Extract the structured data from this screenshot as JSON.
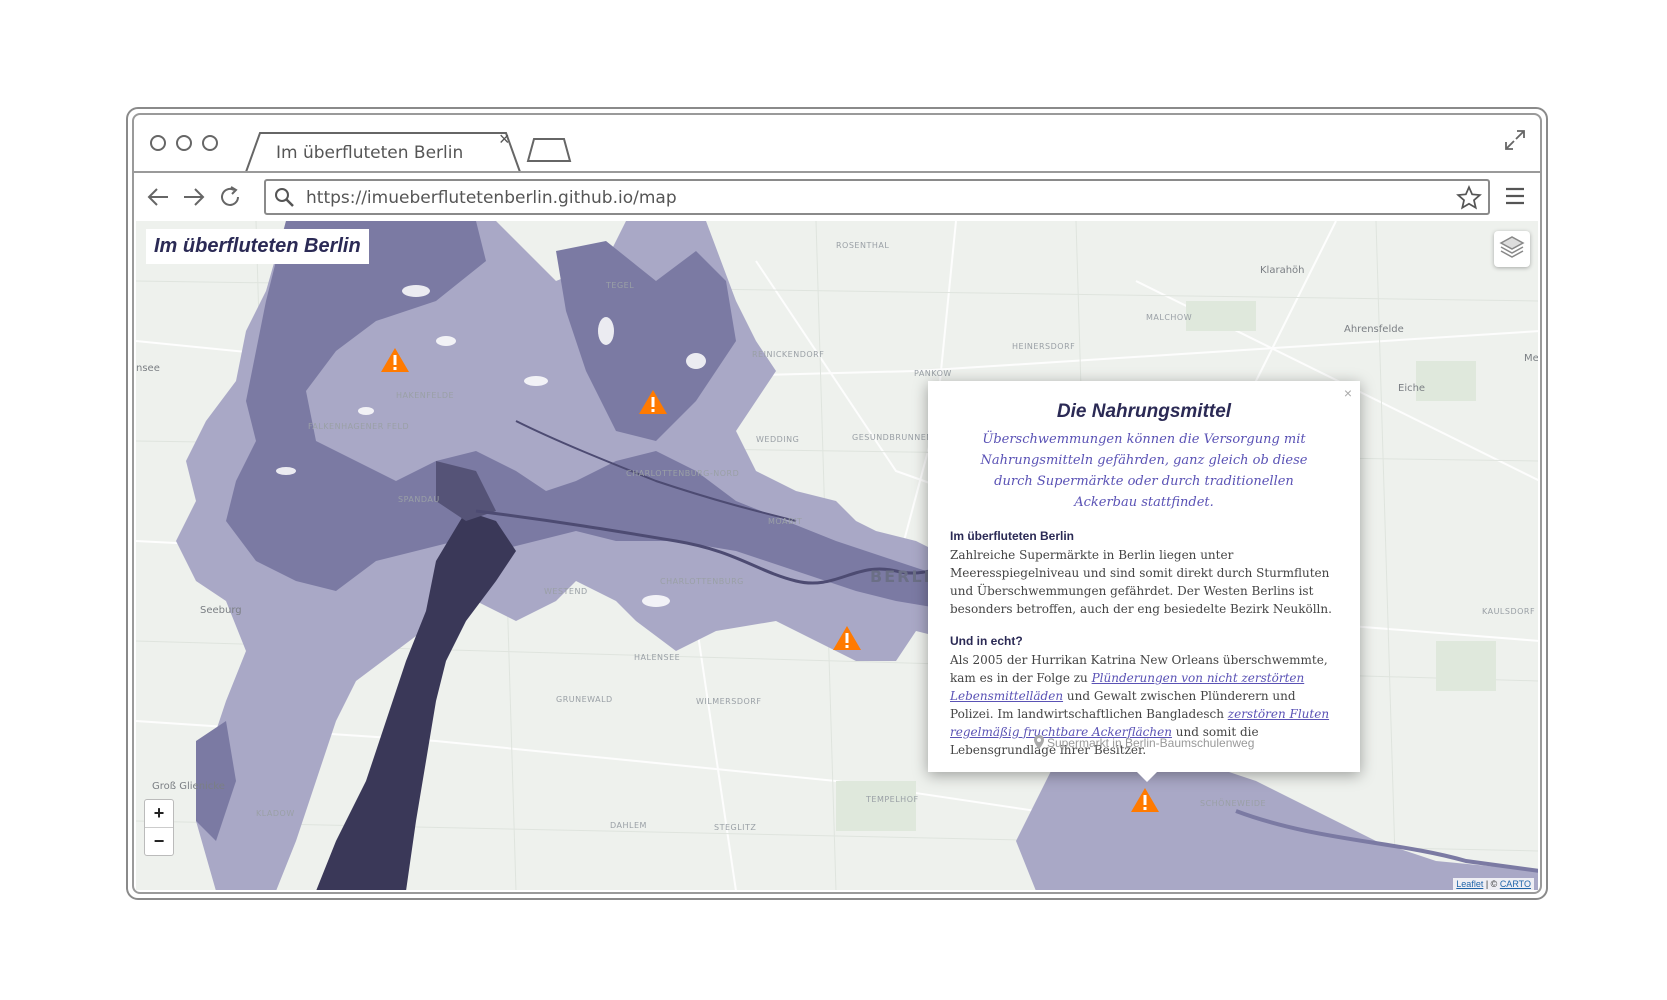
{
  "browser": {
    "tab_title": "Im überfluteten Berlin",
    "tab_close": "×",
    "url": "https://imueberflutetenberlin.github.io/map"
  },
  "map": {
    "title": "Im überfluteten Berlin",
    "zoom_in": "+",
    "zoom_out": "−",
    "attribution_leaflet": "Leaflet",
    "attribution_sep": " | © ",
    "attribution_carto": "CARTO",
    "places": {
      "rosenthal": "ROSENTHAL",
      "klaraoh": "Klarahöh",
      "tegel": "TEGEL",
      "malchow": "MALCHOW",
      "ahrensfelde": "Ahrensfelde",
      "heinersdorf": "HEINERSDORF",
      "reinickendorf": "REINICKENDORF",
      "see": "nsee",
      "mahlsdorf": "Me",
      "pankow": "PANKOW",
      "eiche": "Eiche",
      "falkenhagener": "FALKENHAGENER FELD",
      "wedding": "WEDDING",
      "gesundbrunnen": "GESUNDBRUNNEN",
      "hakenfelde": "HAKENFELDE",
      "spandau": "SPANDAU",
      "charlottenburg_nord": "CHARLOTTENBURG-NORD",
      "moabit": "MOABIT",
      "berlin": "BERLIN",
      "westend": "WESTEND",
      "charlottenburg": "CHARLOTTENBURG",
      "seeburg": "Seeburg",
      "halensee": "HALENSEE",
      "grunewald": "GRUNEWALD",
      "wilmersdorf": "WILMERSDORF",
      "gross_glienicke": "Groß Glienicke",
      "kladow": "KLADOW",
      "dahlem": "DAHLEM",
      "steglitz": "STEGLITZ",
      "tempelhof": "TEMPELHOF",
      "schoeneweide": "SCHÖNEWEIDE",
      "kaulsdorf": "KAULSDORF"
    }
  },
  "popup": {
    "close": "×",
    "title": "Die Nahrungsmittel",
    "subtitle": "Überschwemmungen können die Versorgung mit Nahrungsmitteln gefährden, ganz gleich ob diese durch Supermärkte oder durch traditionellen Ackerbau stattfindet.",
    "section1_heading": "Im überfluteten Berlin",
    "section1_text": "Zahlreiche Supermärkte in Berlin liegen unter Meeresspiegelniveau und sind somit direkt durch Sturmfluten und Überschwemmungen gefährdet. Der Westen Berlins ist besonders betroffen, auch der eng besiedelte Bezirk Neukölln.",
    "section2_heading": "Und in echt?",
    "section2_text_a": "Als 2005 der Hurrikan Katrina New Orleans überschwemmte, kam es in der Folge zu ",
    "section2_link1": "Plünderungen von nicht zerstörten Lebensmittelläden",
    "section2_text_b": " und Gewalt zwischen Plünderern und Polizei. Im landwirtschaftlichen Bangladesch ",
    "section2_link2": "zerstören Fluten regelmäßig fruchtbare Ackerflächen",
    "section2_text_c": " und somit die Lebensgrundlage ihrer Besitzer.",
    "location": "Supermarkt in Berlin-Baumschulenweg"
  },
  "colors": {
    "flood_light": "#a9a8c6",
    "flood_mid": "#7b7aa3",
    "flood_dark": "#3a3858",
    "warning": "#ff7a00",
    "title_text": "#2b2a55",
    "link": "#5a52b5"
  }
}
